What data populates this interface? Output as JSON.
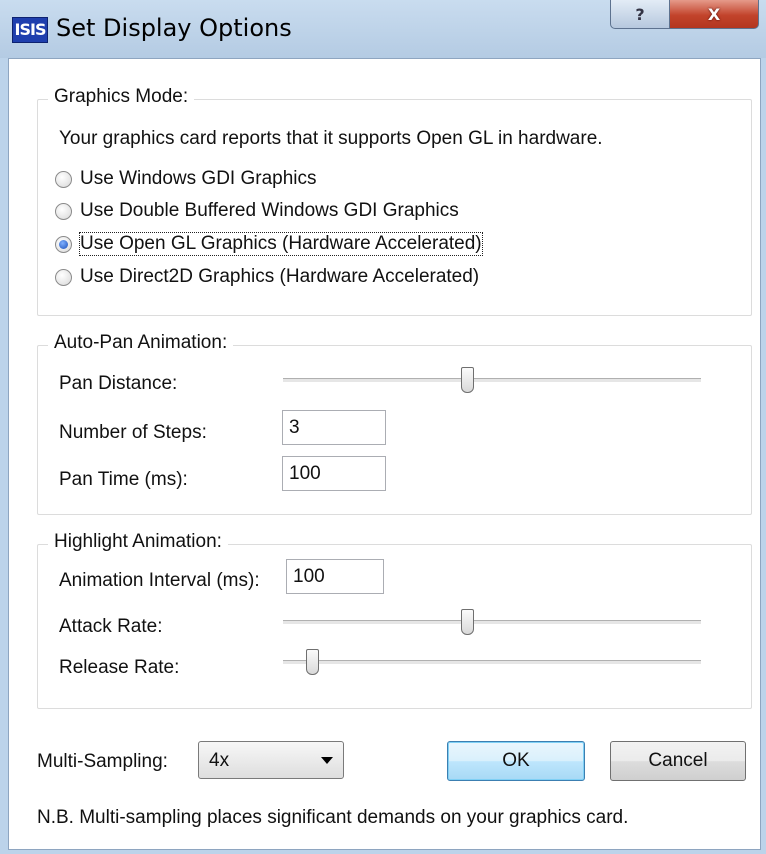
{
  "window": {
    "app_icon_text": "ISIS",
    "title": "Set Display Options",
    "help_button": "?",
    "close_button": "X"
  },
  "graphics_mode": {
    "legend": "Graphics Mode:",
    "info": "Your graphics card reports that it supports Open GL in hardware.",
    "options": [
      {
        "label": "Use Windows GDI Graphics",
        "checked": false
      },
      {
        "label": "Use Double Buffered Windows GDI Graphics",
        "checked": false
      },
      {
        "label": "Use Open GL Graphics (Hardware Accelerated)",
        "checked": true
      },
      {
        "label": "Use Direct2D Graphics (Hardware Accelerated)",
        "checked": false
      }
    ]
  },
  "auto_pan": {
    "legend": "Auto-Pan Animation:",
    "pan_distance_label": "Pan Distance:",
    "pan_distance_level": 0.44,
    "steps_label": "Number of Steps:",
    "steps_value": "3",
    "pan_time_label": "Pan Time (ms):",
    "pan_time_value": "100"
  },
  "highlight": {
    "legend": "Highlight Animation:",
    "interval_label": "Animation Interval (ms):",
    "interval_value": "100",
    "attack_label": "Attack Rate:",
    "attack_level": 0.44,
    "release_label": "Release Rate:",
    "release_level": 0.07
  },
  "footer": {
    "multisampling_label": "Multi-Sampling:",
    "multisampling_value": "4x",
    "ok_label": "OK",
    "cancel_label": "Cancel",
    "note": "N.B. Multi-sampling places significant demands on your graphics card."
  },
  "colors": {
    "title_bar": "#bcd3ea",
    "close_button": "#c2432b",
    "default_button": "#bee6fd"
  }
}
